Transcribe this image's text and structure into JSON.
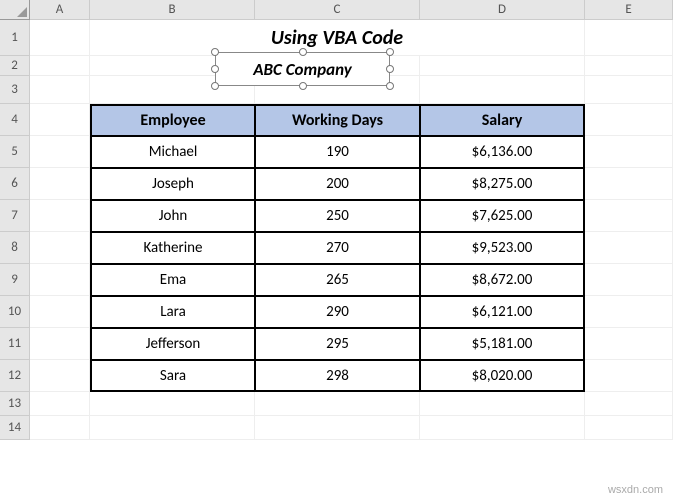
{
  "columns": [
    "",
    "A",
    "B",
    "C",
    "D",
    "E"
  ],
  "rows": [
    "1",
    "2",
    "3",
    "4",
    "5",
    "6",
    "7",
    "8",
    "9",
    "10",
    "11",
    "12",
    "13",
    "14"
  ],
  "title": "Using VBA Code",
  "subtitle": "ABC Company",
  "headers": {
    "employee": "Employee",
    "working_days": "Working Days",
    "salary": "Salary"
  },
  "table": [
    {
      "employee": "Michael",
      "working_days": "190",
      "salary": "$6,136.00"
    },
    {
      "employee": "Joseph",
      "working_days": "200",
      "salary": "$8,275.00"
    },
    {
      "employee": "John",
      "working_days": "250",
      "salary": "$7,625.00"
    },
    {
      "employee": "Katherine",
      "working_days": "270",
      "salary": "$9,523.00"
    },
    {
      "employee": "Ema",
      "working_days": "265",
      "salary": "$8,672.00"
    },
    {
      "employee": "Lara",
      "working_days": "290",
      "salary": "$6,121.00"
    },
    {
      "employee": "Jefferson",
      "working_days": "295",
      "salary": "$5,181.00"
    },
    {
      "employee": "Sara",
      "working_days": "298",
      "salary": "$8,020.00"
    }
  ],
  "watermark": "wsxdn.com"
}
